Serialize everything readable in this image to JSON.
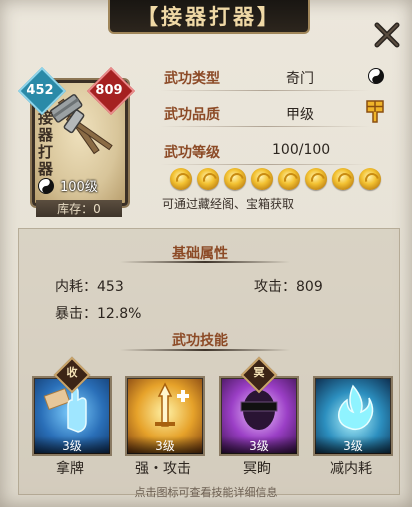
{
  "window": {
    "title": "【接器打器】"
  },
  "card": {
    "name": "接器打器",
    "stat_left": "452",
    "stat_right": "809",
    "level": "100级",
    "stock": "库存：0"
  },
  "info": [
    {
      "label": "武功类型",
      "value": "奇门",
      "icon": "yinyang-icon"
    },
    {
      "label": "武功品质",
      "value": "甲级",
      "icon": "grade-jia-icon"
    },
    {
      "label": "武功等级",
      "value": "100/100"
    }
  ],
  "stars_count": 8,
  "acquire_hint": "可通过藏经阁、宝箱获取",
  "basic": {
    "title": "基础属性",
    "neihao": "内耗：453",
    "gongji": "攻击：809",
    "baoji": "暴击：12.8%"
  },
  "skills": {
    "title": "武功技能",
    "items": [
      {
        "name": "拿牌",
        "level": "3级",
        "tag": "收"
      },
      {
        "name": "强・攻击",
        "level": "3级",
        "tag": ""
      },
      {
        "name": "冥眗",
        "level": "3级",
        "tag": "冥"
      },
      {
        "name": "减内耗",
        "level": "3级",
        "tag": ""
      }
    ]
  },
  "footer": "点击图标可查看技能详细信息",
  "colors": {
    "accent": "#8c4a26",
    "gold": "#f3c232",
    "frame": "#a0865a"
  }
}
